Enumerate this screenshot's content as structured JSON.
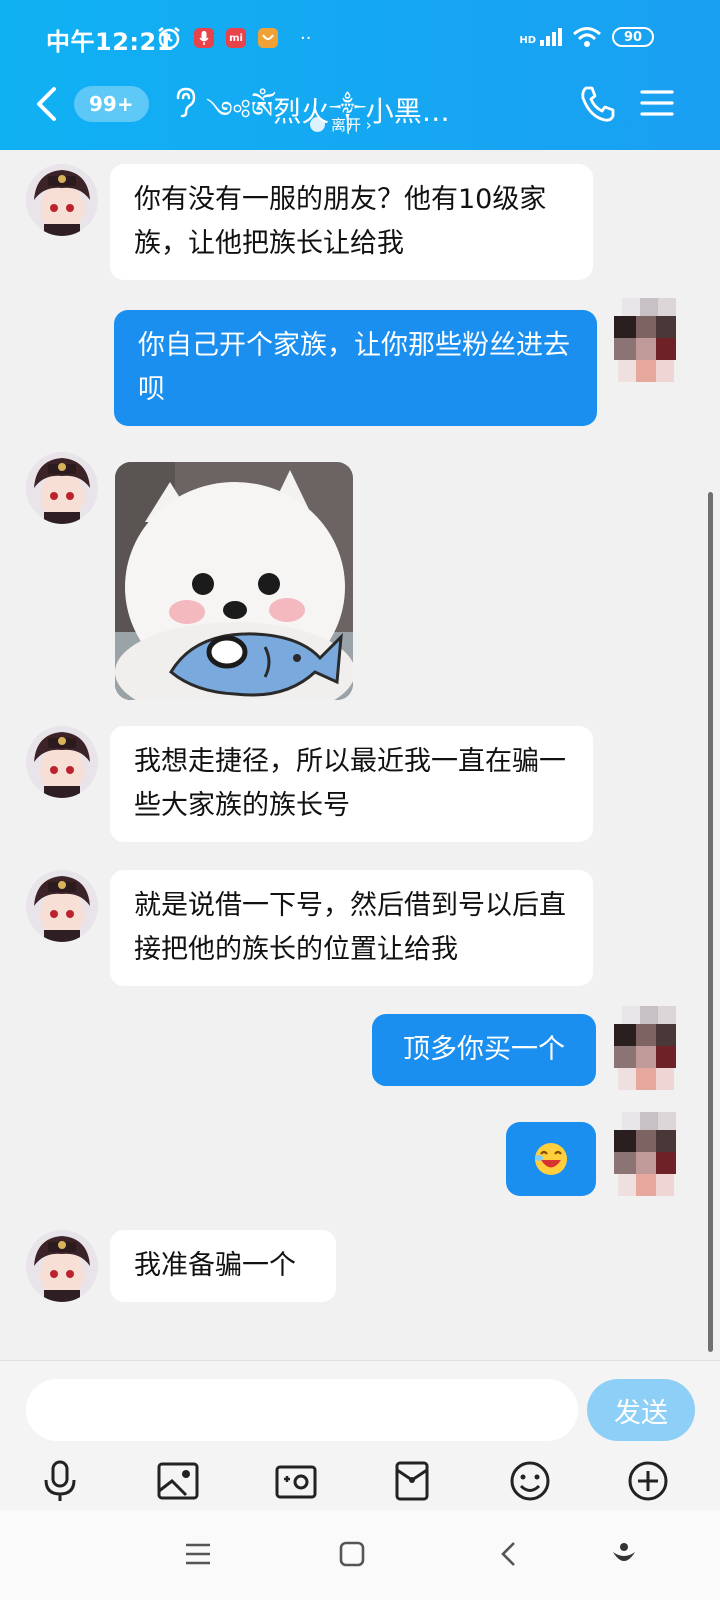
{
  "status_bar": {
    "time": "中午12:21",
    "notif_chip_1": "mi",
    "more_dots": "··",
    "network": "HD",
    "battery": "90"
  },
  "header": {
    "unread_count": "99+",
    "title": "༺ༀ烈火༒小黑…",
    "presence": "离开 ›"
  },
  "messages": [
    {
      "from": "other",
      "text": "你有没有一服的朋友？他有10级家族，让他把族长让给我"
    },
    {
      "from": "self",
      "text": "你自己开个家族，让你那些粉丝进去呗"
    },
    {
      "from": "other",
      "type": "sticker",
      "sticker": "white-dog-holding-fish"
    },
    {
      "from": "other",
      "text": "我想走捷径，所以最近我一直在骗一些大家族的族长号"
    },
    {
      "from": "other",
      "text": "就是说借一下号，然后借到号以后直接把他的族长的位置让给我"
    },
    {
      "from": "self",
      "text": "顶多你买一个"
    },
    {
      "from": "self",
      "type": "emoji",
      "emoji": "laughing-face"
    },
    {
      "from": "other",
      "text": "我准备骗一个"
    }
  ],
  "input": {
    "placeholder": "",
    "send_label": "发送"
  },
  "tools": [
    "microphone-icon",
    "image-icon",
    "camera-icon",
    "red-packet-icon",
    "emoji-icon",
    "plus-icon"
  ],
  "colors": {
    "header": "#1aa8f3",
    "self_bubble": "#1b8ff0",
    "other_bubble": "#ffffff",
    "background": "#f1f1f1",
    "send_button": "#8ecff7"
  }
}
